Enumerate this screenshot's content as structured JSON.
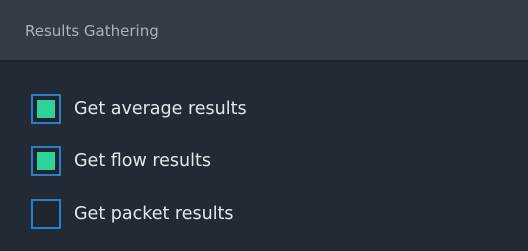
{
  "panel": {
    "title": "Results Gathering",
    "checkboxes": [
      {
        "label": "Get average results",
        "checked": true
      },
      {
        "label": "Get flow results",
        "checked": true
      },
      {
        "label": "Get packet results",
        "checked": false
      }
    ]
  },
  "colors": {
    "header_bg": "#313c47",
    "body_bg": "#222b35",
    "checkbox_border": "#2c7ec8",
    "checkbox_fill": "#2ed39a"
  }
}
